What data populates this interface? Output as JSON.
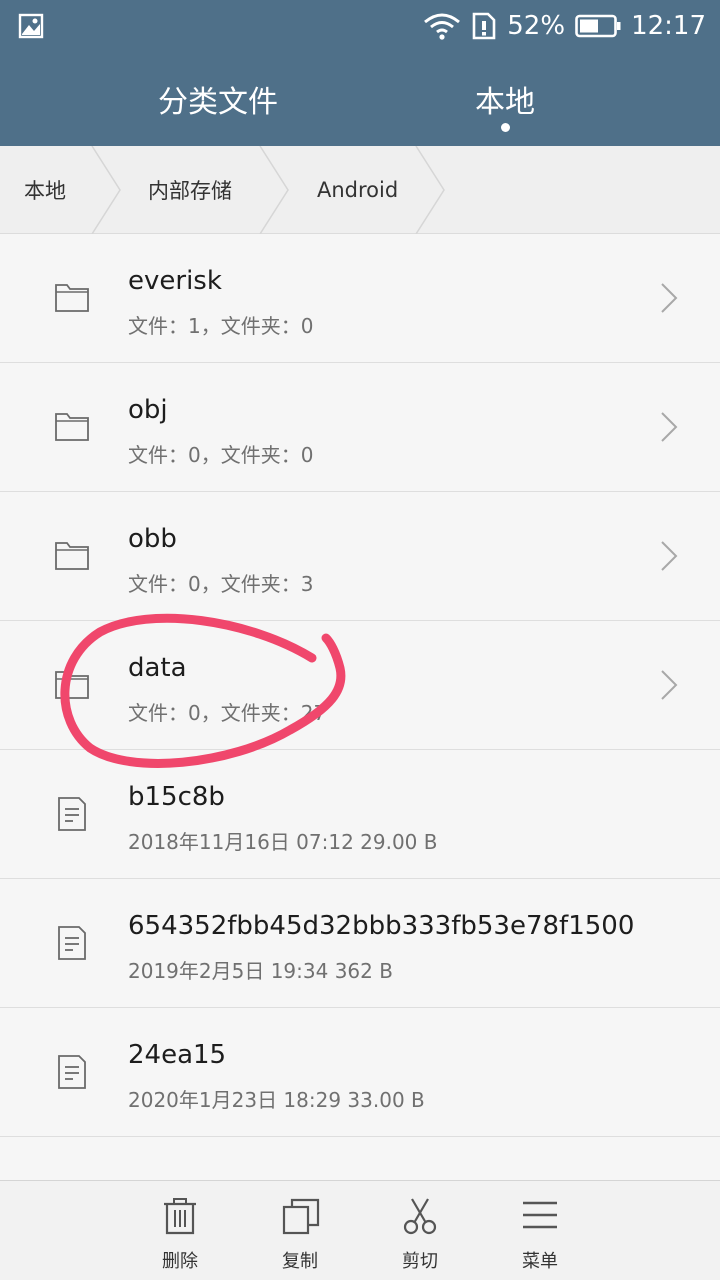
{
  "status_bar": {
    "battery": "52%",
    "time": "12:17"
  },
  "header": {
    "tabs": [
      {
        "label": "分类文件",
        "active": false
      },
      {
        "label": "本地",
        "active": true
      }
    ]
  },
  "breadcrumb": [
    "本地",
    "内部存储",
    "Android"
  ],
  "items": [
    {
      "type": "folder",
      "name": "everisk",
      "meta": "文件：1，文件夹：0"
    },
    {
      "type": "folder",
      "name": "obj",
      "meta": "文件：0，文件夹：0"
    },
    {
      "type": "folder",
      "name": "obb",
      "meta": "文件：0，文件夹：3"
    },
    {
      "type": "folder",
      "name": "data",
      "meta": "文件：0，文件夹：27"
    },
    {
      "type": "file",
      "name": "b15c8b",
      "meta": "2018年11月16日 07:12 29.00 B"
    },
    {
      "type": "file",
      "name": "654352fbb45d32bbb333fb53e78f1500",
      "meta": "2019年2月5日 19:34 362 B"
    },
    {
      "type": "file",
      "name": "24ea15",
      "meta": "2020年1月23日 18:29 33.00 B"
    }
  ],
  "toolbar": {
    "delete": "删除",
    "copy": "复制",
    "cut": "剪切",
    "menu": "菜单"
  },
  "colors": {
    "header": "#4f7089",
    "annotation": "#f0476c"
  }
}
